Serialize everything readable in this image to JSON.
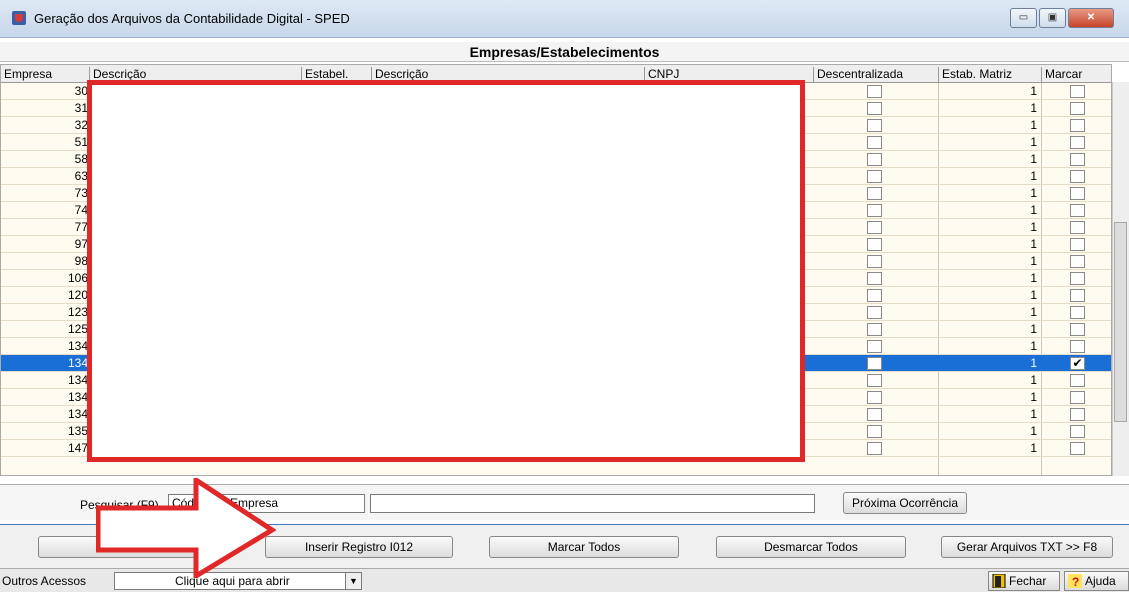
{
  "window": {
    "title": "Geração dos Arquivos da Contabilidade Digital  - SPED",
    "min": "▭",
    "max": "▣",
    "close": "✕"
  },
  "panel_title": "Empresas/Estabelecimentos",
  "columns": [
    "Empresa",
    "Descrição",
    "Estabel.",
    "Descrição",
    "CNPJ",
    "Descentralizada",
    "Estab. Matriz",
    "Marcar"
  ],
  "rows": [
    {
      "empresa": "30",
      "matriz": "1",
      "marcar": ""
    },
    {
      "empresa": "31",
      "matriz": "1",
      "marcar": ""
    },
    {
      "empresa": "32",
      "matriz": "1",
      "marcar": ""
    },
    {
      "empresa": "51",
      "matriz": "1",
      "marcar": ""
    },
    {
      "empresa": "58",
      "matriz": "1",
      "marcar": ""
    },
    {
      "empresa": "63",
      "matriz": "1",
      "marcar": ""
    },
    {
      "empresa": "73",
      "matriz": "1",
      "marcar": ""
    },
    {
      "empresa": "74",
      "matriz": "1",
      "marcar": ""
    },
    {
      "empresa": "77",
      "matriz": "1",
      "marcar": ""
    },
    {
      "empresa": "97",
      "matriz": "1",
      "marcar": ""
    },
    {
      "empresa": "98",
      "matriz": "1",
      "marcar": ""
    },
    {
      "empresa": "106",
      "matriz": "1",
      "marcar": ""
    },
    {
      "empresa": "120",
      "matriz": "1",
      "marcar": ""
    },
    {
      "empresa": "123",
      "matriz": "1",
      "marcar": ""
    },
    {
      "empresa": "125",
      "matriz": "1",
      "marcar": ""
    },
    {
      "empresa": "134",
      "matriz": "1",
      "marcar": ""
    },
    {
      "empresa": "134",
      "matriz": "1",
      "marcar": "✔"
    },
    {
      "empresa": "134",
      "matriz": "1",
      "marcar": ""
    },
    {
      "empresa": "134",
      "matriz": "1",
      "marcar": ""
    },
    {
      "empresa": "134",
      "matriz": "1",
      "marcar": ""
    },
    {
      "empresa": "135",
      "matriz": "1",
      "marcar": ""
    },
    {
      "empresa": "147",
      "matriz": "1",
      "marcar": ""
    }
  ],
  "search": {
    "label": "Pesquisar (F9)",
    "field_value": "Código da Empresa",
    "query_value": "",
    "next_button": "Próxima Ocorrência"
  },
  "actions": {
    "inserir": "Inserir Registro I012",
    "marcar_todos": "Marcar Todos",
    "desmarcar_todos": "Desmarcar Todos",
    "gerar": "Gerar Arquivos TXT >> F8"
  },
  "footer": {
    "label": "Outros Acessos",
    "combo_value": "Clique aqui para abrir",
    "combo_arrow": "▼",
    "fechar": "Fechar",
    "ajuda": "Ajuda"
  },
  "colors": {
    "selection": "#1a6fd6",
    "highlight_box": "#e02828"
  }
}
